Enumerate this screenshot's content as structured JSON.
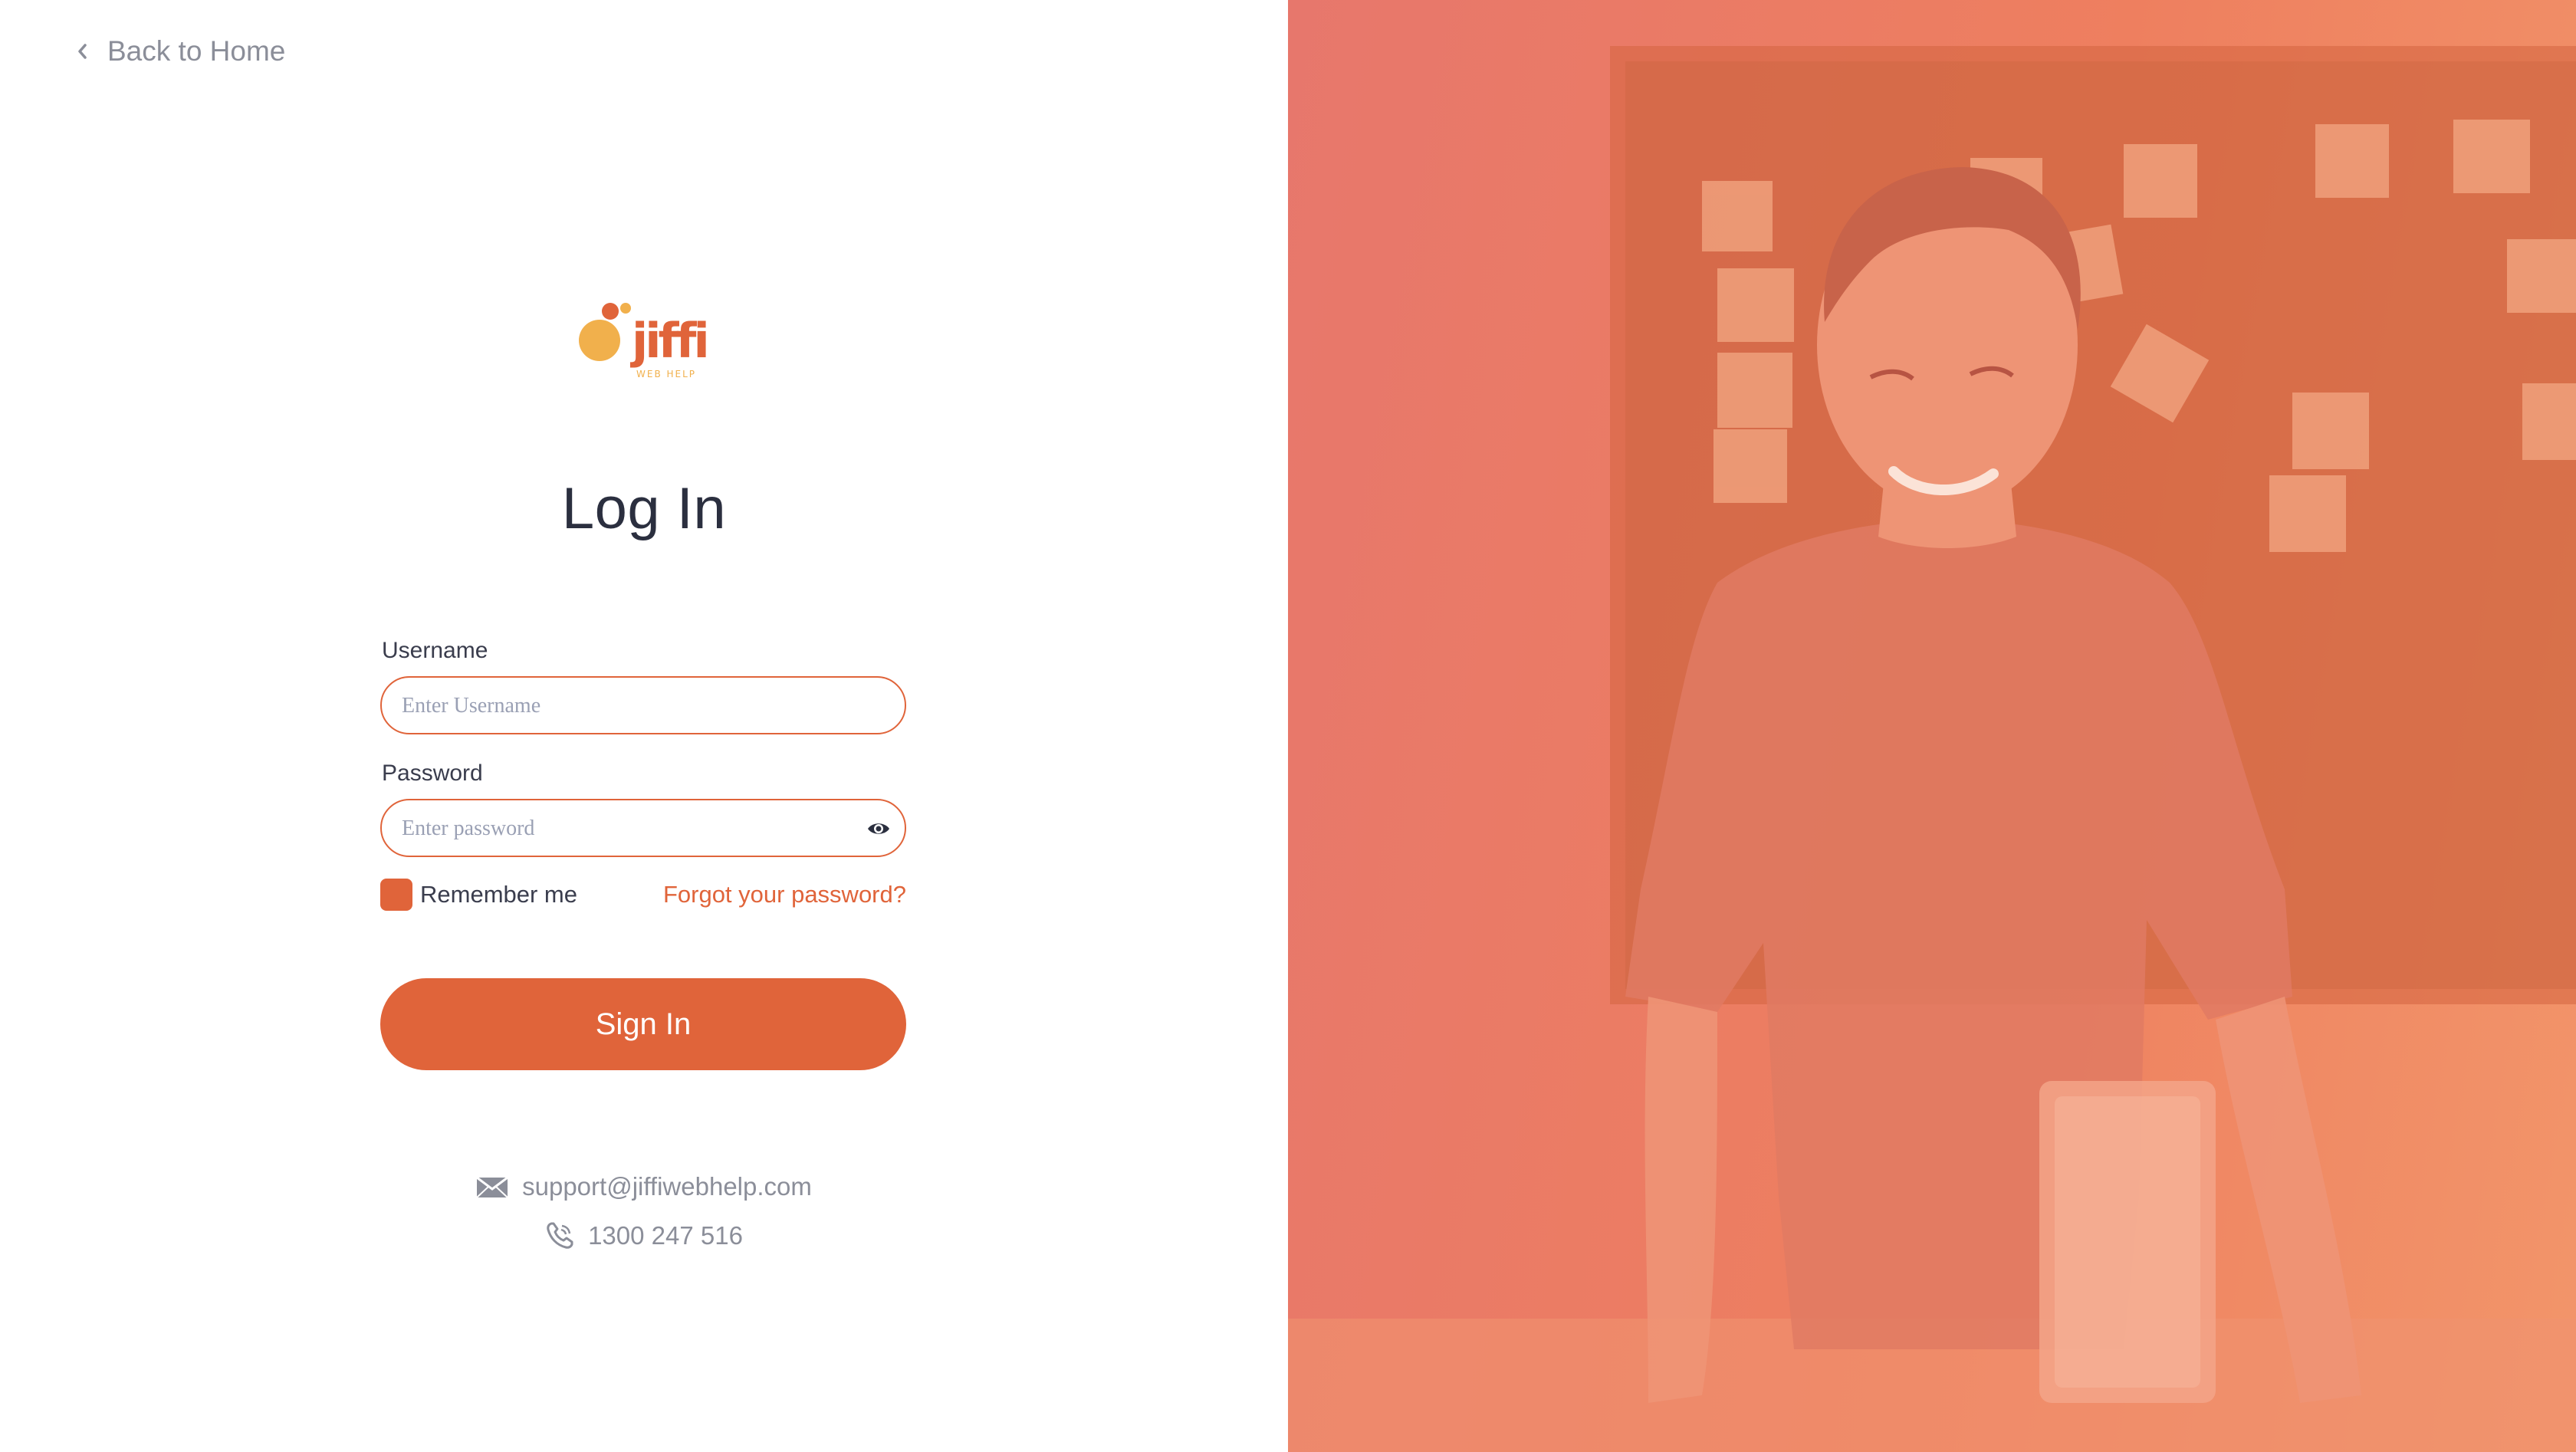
{
  "nav": {
    "back_label": "Back to Home"
  },
  "brand": {
    "logo_text": "jiffi",
    "logo_subtext": "WEB HELP",
    "accent_color": "#e0643a",
    "accent_light": "#f1b04c"
  },
  "login": {
    "title": "Log In",
    "username": {
      "label": "Username",
      "placeholder": "Enter Username",
      "value": ""
    },
    "password": {
      "label": "Password",
      "placeholder": "Enter password",
      "value": ""
    },
    "remember_label": "Remember me",
    "remember_checked": true,
    "forgot_label": "Forgot your password?",
    "submit_label": "Sign In"
  },
  "contact": {
    "email": "support@jiffiwebhelp.com",
    "phone": "1300 247 516"
  },
  "icons": {
    "back": "chevron-left-icon",
    "eye": "eye-icon",
    "email": "envelope-icon",
    "phone": "phone-icon"
  }
}
